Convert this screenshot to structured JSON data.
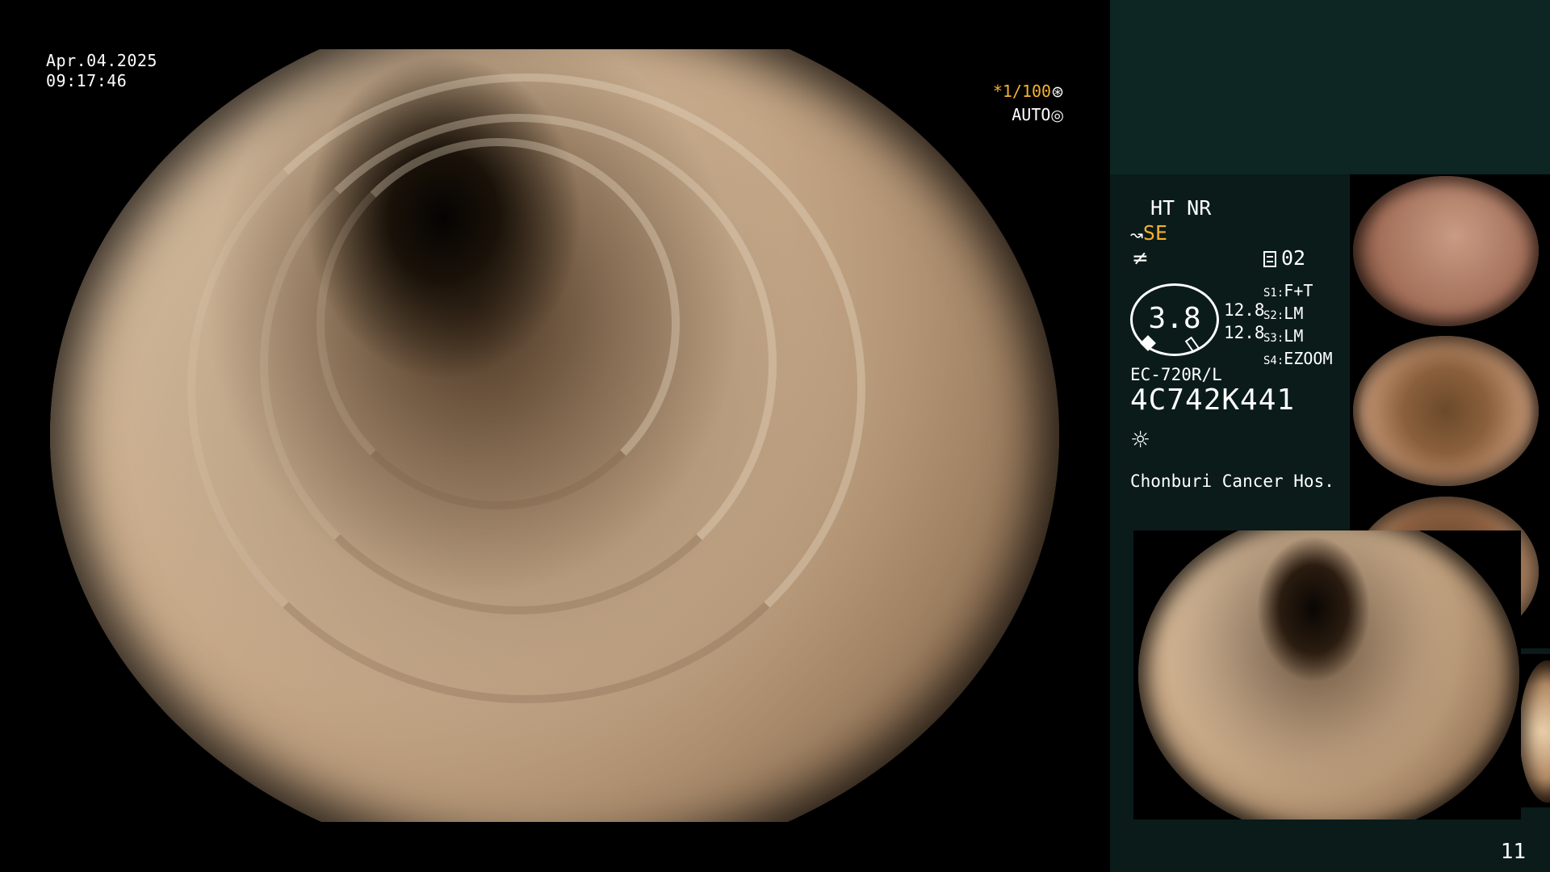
{
  "overlay": {
    "date": "Apr.04.2025",
    "time": "09:17:46",
    "shutter": "*1/100",
    "shutter_icon": "aperture-icon",
    "exposure_mode": "AUTO",
    "exposure_icon": "target-icon"
  },
  "panel": {
    "mode_line1": "HT NR",
    "mode_line2": "SE",
    "mode_line3": "≠",
    "channel": "02",
    "gauge_value": "3.8",
    "readings": [
      "12.8",
      "12.8"
    ],
    "scope_slots": [
      {
        "slot": "S1:",
        "value": "F+T"
      },
      {
        "slot": "S2:",
        "value": "LM"
      },
      {
        "slot": "S3:",
        "value": "LM"
      },
      {
        "slot": "S4:",
        "value": "EZOOM"
      }
    ],
    "scope_model": "EC-720R/L",
    "serial": "4C742K441",
    "light_icon": "sun-icon",
    "hospital": "Chonburi Cancer Hos."
  },
  "page_number": "11",
  "colors": {
    "accent_orange": "#f5b12a",
    "panel_top": "#0d2523",
    "panel_bg": "#0a1b1a"
  }
}
